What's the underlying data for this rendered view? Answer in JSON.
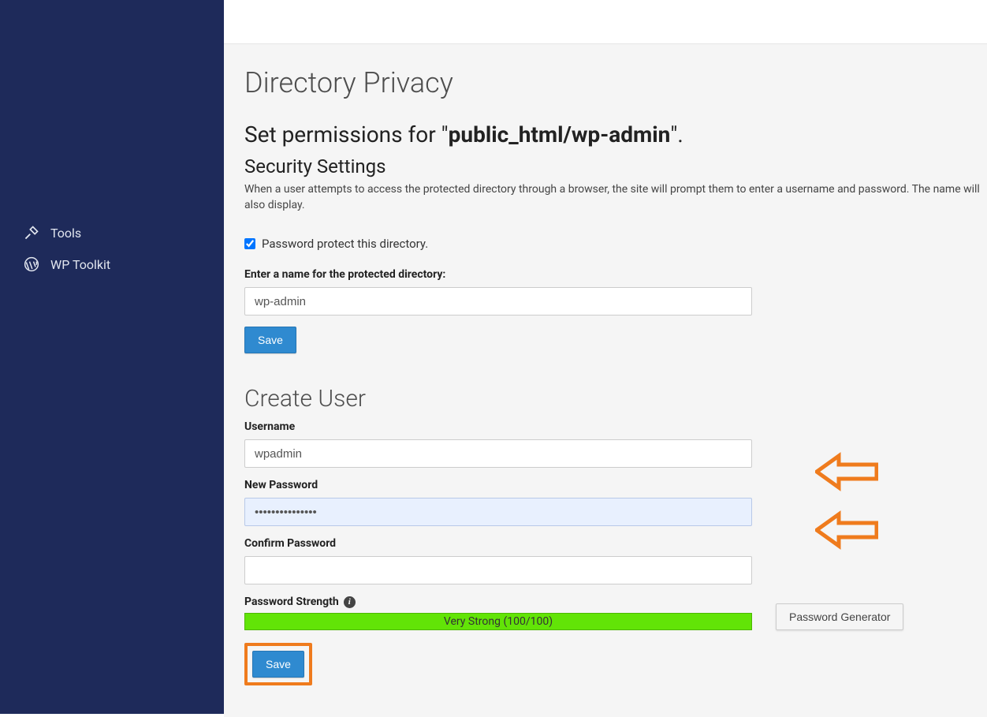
{
  "sidebar": {
    "items": [
      {
        "label": "Tools",
        "icon": "tools-icon"
      },
      {
        "label": "WP Toolkit",
        "icon": "wordpress-icon"
      }
    ]
  },
  "page": {
    "title": "Directory Privacy",
    "subtitle_prefix": "Set permissions for \"",
    "subtitle_path": "public_html/wp-admin",
    "subtitle_suffix": "\"."
  },
  "security": {
    "heading": "Security Settings",
    "description": "When a user attempts to access the protected directory through a browser, the site will prompt them to enter a username and password. The name will also display.",
    "checkbox_label": "Password protect this directory.",
    "checkbox_checked": true,
    "dirname_label": "Enter a name for the protected directory:",
    "dirname_value": "wp-admin",
    "save_label": "Save"
  },
  "create_user": {
    "heading": "Create User",
    "username_label": "Username",
    "username_value": "wpadmin",
    "newpass_label": "New Password",
    "newpass_value": "•••••••••••••••",
    "confirm_label": "Confirm Password",
    "confirm_value": "",
    "strength_label": "Password Strength",
    "strength_text": "Very Strong (100/100)",
    "generator_label": "Password Generator",
    "save_label": "Save"
  },
  "colors": {
    "sidebar_bg": "#1e2a5a",
    "primary_btn": "#2f8ad0",
    "strength_bar": "#62e407",
    "highlight_border": "#ef7b1d"
  }
}
